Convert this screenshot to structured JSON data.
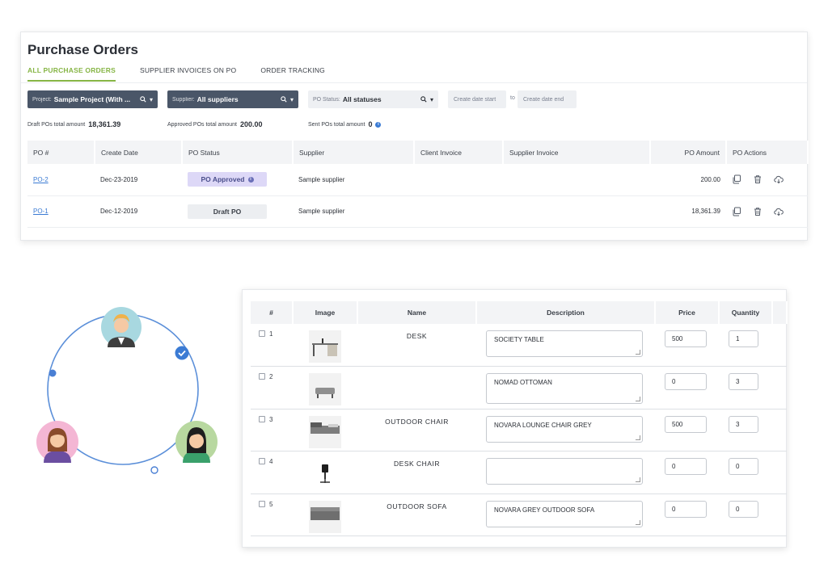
{
  "page_title": "Purchase Orders",
  "tabs": [
    {
      "label": "ALL PURCHASE ORDERS",
      "active": true
    },
    {
      "label": "SUPPLIER INVOICES ON PO",
      "active": false
    },
    {
      "label": "ORDER TRACKING",
      "active": false
    }
  ],
  "filters": {
    "project": {
      "label": "Project:",
      "value": "Sample Project (With ..."
    },
    "supplier": {
      "label": "Supplier:",
      "value": "All suppliers"
    },
    "po_status": {
      "label": "PO Status:",
      "value": "All statuses"
    },
    "date_start_placeholder": "Create date start",
    "date_to": "to",
    "date_end_placeholder": "Create date end"
  },
  "totals": {
    "draft": {
      "label": "Draft POs total amount",
      "value": "18,361.39"
    },
    "approved": {
      "label": "Approved POs total amount",
      "value": "200.00"
    },
    "sent": {
      "label": "Sent POs total amount",
      "value": "0"
    }
  },
  "po_table": {
    "headers": [
      "PO #",
      "Create Date",
      "PO Status",
      "Supplier",
      "Client Invoice",
      "Supplier Invoice",
      "PO Amount",
      "PO Actions"
    ],
    "rows": [
      {
        "po": "PO-2",
        "date": "Dec-23-2019",
        "status": "PO Approved",
        "supplier": "Sample supplier",
        "client_invoice": "",
        "supplier_invoice": "",
        "amount": "200.00"
      },
      {
        "po": "PO-1",
        "date": "Dec-12-2019",
        "status": "Draft PO",
        "supplier": "Sample supplier",
        "client_invoice": "",
        "supplier_invoice": "",
        "amount": "18,361.39"
      }
    ]
  },
  "items_table": {
    "headers": [
      "#",
      "Image",
      "Name",
      "Description",
      "Price",
      "Quantity"
    ],
    "rows": [
      {
        "num": "1",
        "name": "DESK",
        "description": "SOCIETY TABLE",
        "price": "500",
        "quantity": "1",
        "image": "desk-image"
      },
      {
        "num": "2",
        "name": "",
        "description": "NOMAD OTTOMAN",
        "price": "0",
        "quantity": "3",
        "image": "ottoman-image"
      },
      {
        "num": "3",
        "name": "OUTDOOR CHAIR",
        "description": "NOVARA LOUNGE CHAIR GREY",
        "price": "500",
        "quantity": "3",
        "image": "lounge-chair-image"
      },
      {
        "num": "4",
        "name": "DESK CHAIR",
        "description": "",
        "price": "0",
        "quantity": "0",
        "image": "desk-chair-image"
      },
      {
        "num": "5",
        "name": "OUTDOOR SOFA",
        "description": "NOVARA GREY OUTDOOR SOFA",
        "price": "0",
        "quantity": "0",
        "image": "sofa-image"
      }
    ]
  },
  "colors": {
    "accent_green": "#86b545",
    "filter_dark": "#4a5668",
    "link_blue": "#3b7bd4",
    "approved_bg": "#ddd8f7"
  }
}
